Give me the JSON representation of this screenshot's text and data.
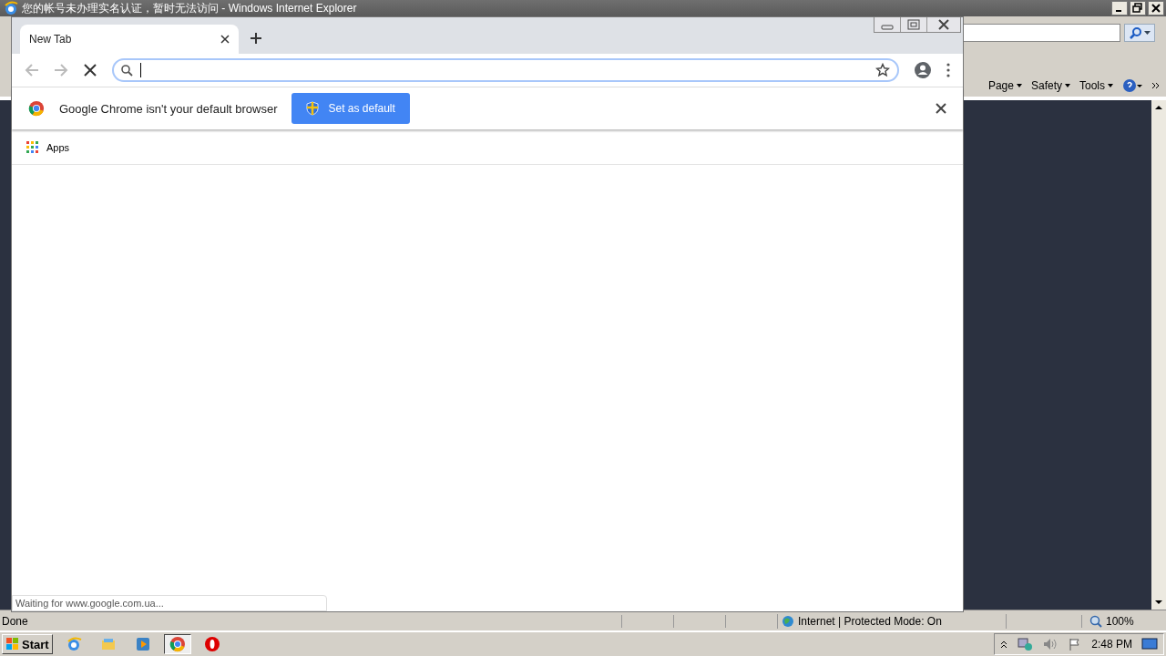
{
  "ie_window": {
    "title": "您的帐号未办理实名认证，暂时无法访问 - Windows Internet Explorer",
    "command_bar": [
      {
        "label": "Page"
      },
      {
        "label": "Safety"
      },
      {
        "label": "Tools"
      }
    ],
    "status": {
      "text": "Done",
      "zone": "Internet | Protected Mode: On",
      "zoom": "100%"
    }
  },
  "chrome": {
    "tabs": [
      {
        "label": "New Tab",
        "selected": true
      }
    ],
    "loading": true,
    "infobar": {
      "message": "Google Chrome isn't your default browser",
      "button": "Set as default"
    },
    "bookmarks": [
      {
        "label": "Apps"
      }
    ],
    "status_bubble": "Waiting for www.google.com.ua..."
  },
  "taskbar": {
    "start": "Start",
    "apps": [
      {
        "kind": "ie",
        "selected": false
      },
      {
        "kind": "explorer",
        "selected": false
      },
      {
        "kind": "media",
        "selected": false
      },
      {
        "kind": "chrome",
        "selected": true
      },
      {
        "kind": "opera",
        "selected": false
      }
    ],
    "clock": "2:48 PM"
  }
}
